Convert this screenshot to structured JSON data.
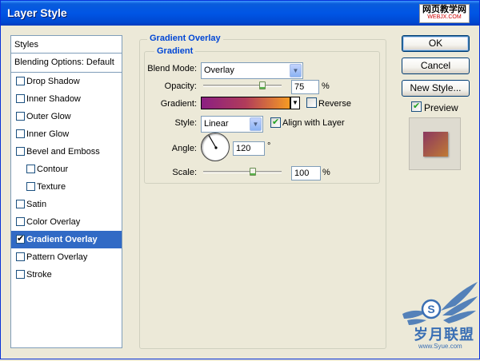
{
  "window": {
    "title": "Layer Style",
    "watermark_top_main": "网页教学网",
    "watermark_top_sub": "WEBJX.COM"
  },
  "styles_list": {
    "header": "Styles",
    "blending": "Blending Options: Default",
    "items": [
      {
        "label": "Drop Shadow",
        "checked": false
      },
      {
        "label": "Inner Shadow",
        "checked": false
      },
      {
        "label": "Outer Glow",
        "checked": false
      },
      {
        "label": "Inner Glow",
        "checked": false
      },
      {
        "label": "Bevel and Emboss",
        "checked": false
      },
      {
        "label": "Contour",
        "checked": false
      },
      {
        "label": "Texture",
        "checked": false
      },
      {
        "label": "Satin",
        "checked": false
      },
      {
        "label": "Color Overlay",
        "checked": false
      },
      {
        "label": "Gradient Overlay",
        "checked": true,
        "selected": true
      },
      {
        "label": "Pattern Overlay",
        "checked": false
      },
      {
        "label": "Stroke",
        "checked": false
      }
    ]
  },
  "panel": {
    "outer_title": "Gradient Overlay",
    "inner_title": "Gradient",
    "blend_mode_label": "Blend Mode:",
    "blend_mode_value": "Overlay",
    "opacity_label": "Opacity:",
    "opacity_value": "75",
    "opacity_unit": "%",
    "opacity_fraction": 0.75,
    "gradient_label": "Gradient:",
    "gradient_colors": [
      "#8b1f82",
      "#b13c5a",
      "#f59b24"
    ],
    "reverse_label": "Reverse",
    "reverse_checked": false,
    "style_label": "Style:",
    "style_value": "Linear",
    "align_label": "Align with Layer",
    "align_checked": true,
    "angle_label": "Angle:",
    "angle_value": "120",
    "angle_unit": "°",
    "scale_label": "Scale:",
    "scale_value": "100",
    "scale_unit": "%"
  },
  "buttons": {
    "ok": "OK",
    "cancel": "Cancel",
    "new_style": "New Style...",
    "preview_label": "Preview",
    "preview_checked": true
  },
  "logo": {
    "text": "岁月联盟",
    "sub": "www.Syue.com"
  },
  "colors": {
    "accent": "#0046d5",
    "selection": "#316ac5",
    "titlebar": "#0055e5"
  }
}
